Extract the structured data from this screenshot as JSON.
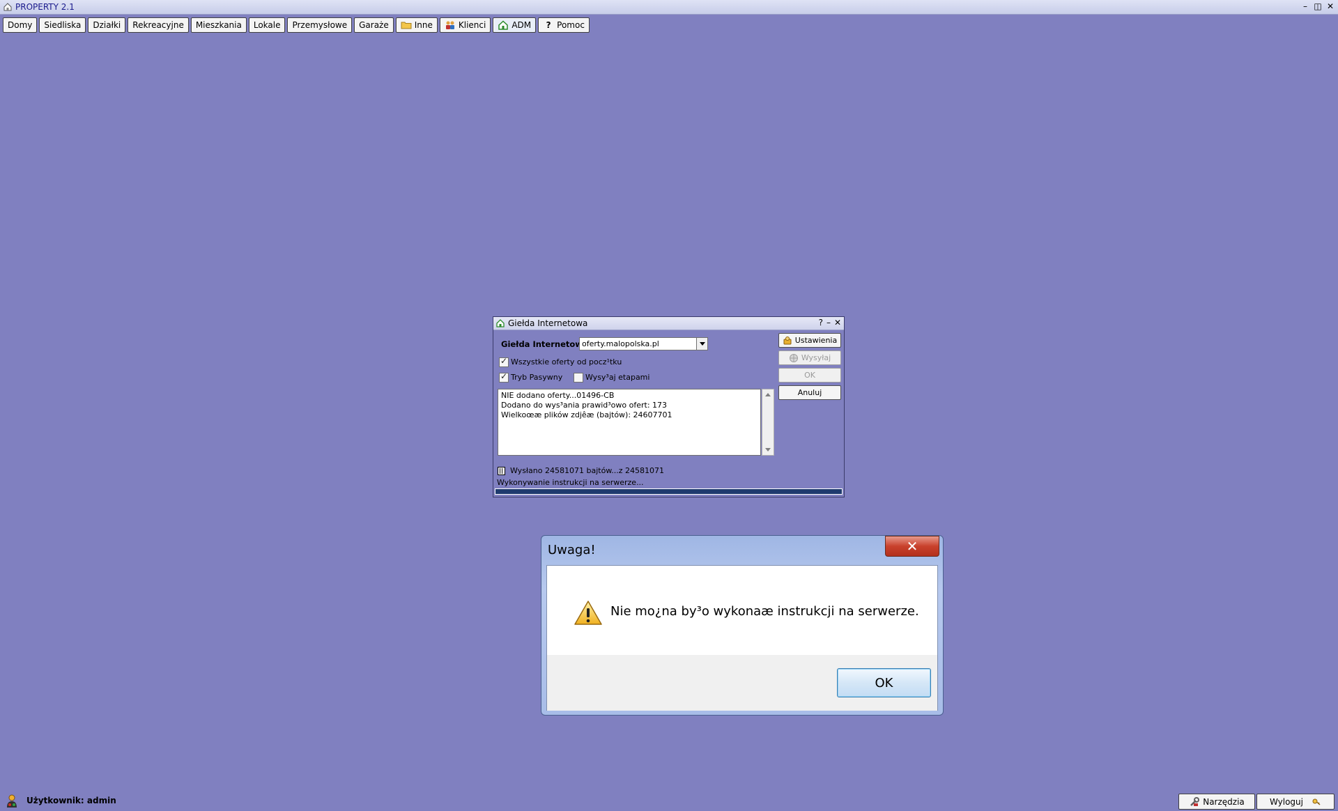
{
  "app": {
    "title": "PROPERTY 2.1"
  },
  "window_controls": {
    "minimize": "–",
    "maximize": "◫",
    "close": "✕"
  },
  "toolbar": {
    "items": [
      {
        "label": "Domy"
      },
      {
        "label": "Siedliska"
      },
      {
        "label": "Działki"
      },
      {
        "label": "Rekreacyjne"
      },
      {
        "label": "Mieszkania"
      },
      {
        "label": "Lokale"
      },
      {
        "label": "Przemysłowe"
      },
      {
        "label": "Garaże"
      },
      {
        "label": "Inne",
        "icon": "folder-icon"
      },
      {
        "label": "Klienci",
        "icon": "users-icon"
      },
      {
        "label": "ADM",
        "icon": "home-icon"
      },
      {
        "label": "Pomoc",
        "icon": "help-icon"
      }
    ]
  },
  "gielda": {
    "title": "Giełda Internetowa",
    "controls": {
      "help": "?",
      "minimize": "–",
      "close": "✕"
    },
    "exchange_label": "Giełda Internetowa:",
    "exchange_value": "oferty.malopolska.pl",
    "all_offers_label": "Wszystkie oferty od pocz¹tku",
    "all_offers_checked": true,
    "passive_label": "Tryb Pasywny",
    "passive_checked": true,
    "stages_label": "Wysy³aj etapami",
    "stages_checked": false,
    "buttons": {
      "settings": "Ustawienia",
      "send": "Wysyłaj",
      "ok": "OK",
      "cancel": "Anuluj"
    },
    "log_lines": [
      "NIE dodano oferty...01496-CB",
      "Dodano do wys³ania prawid³owo ofert: 173",
      "Wielkoœæ plików zdjêæ (bajtów): 24607701"
    ],
    "sent_text": "Wysłano 24581071 bajtów...z 24581071",
    "status_text": "Wykonywanie instrukcji na serwerze...",
    "progress": 1.0
  },
  "dialog": {
    "title": "Uwaga!",
    "message": "Nie mo¿na by³o wykonaæ instrukcji na serwerze.",
    "ok_label": "OK",
    "close_glyph": "✕"
  },
  "statusbar": {
    "user_text": "Użytkownik: admin",
    "tools_label": "Narzędzia",
    "logout_label": "Wyloguj"
  }
}
